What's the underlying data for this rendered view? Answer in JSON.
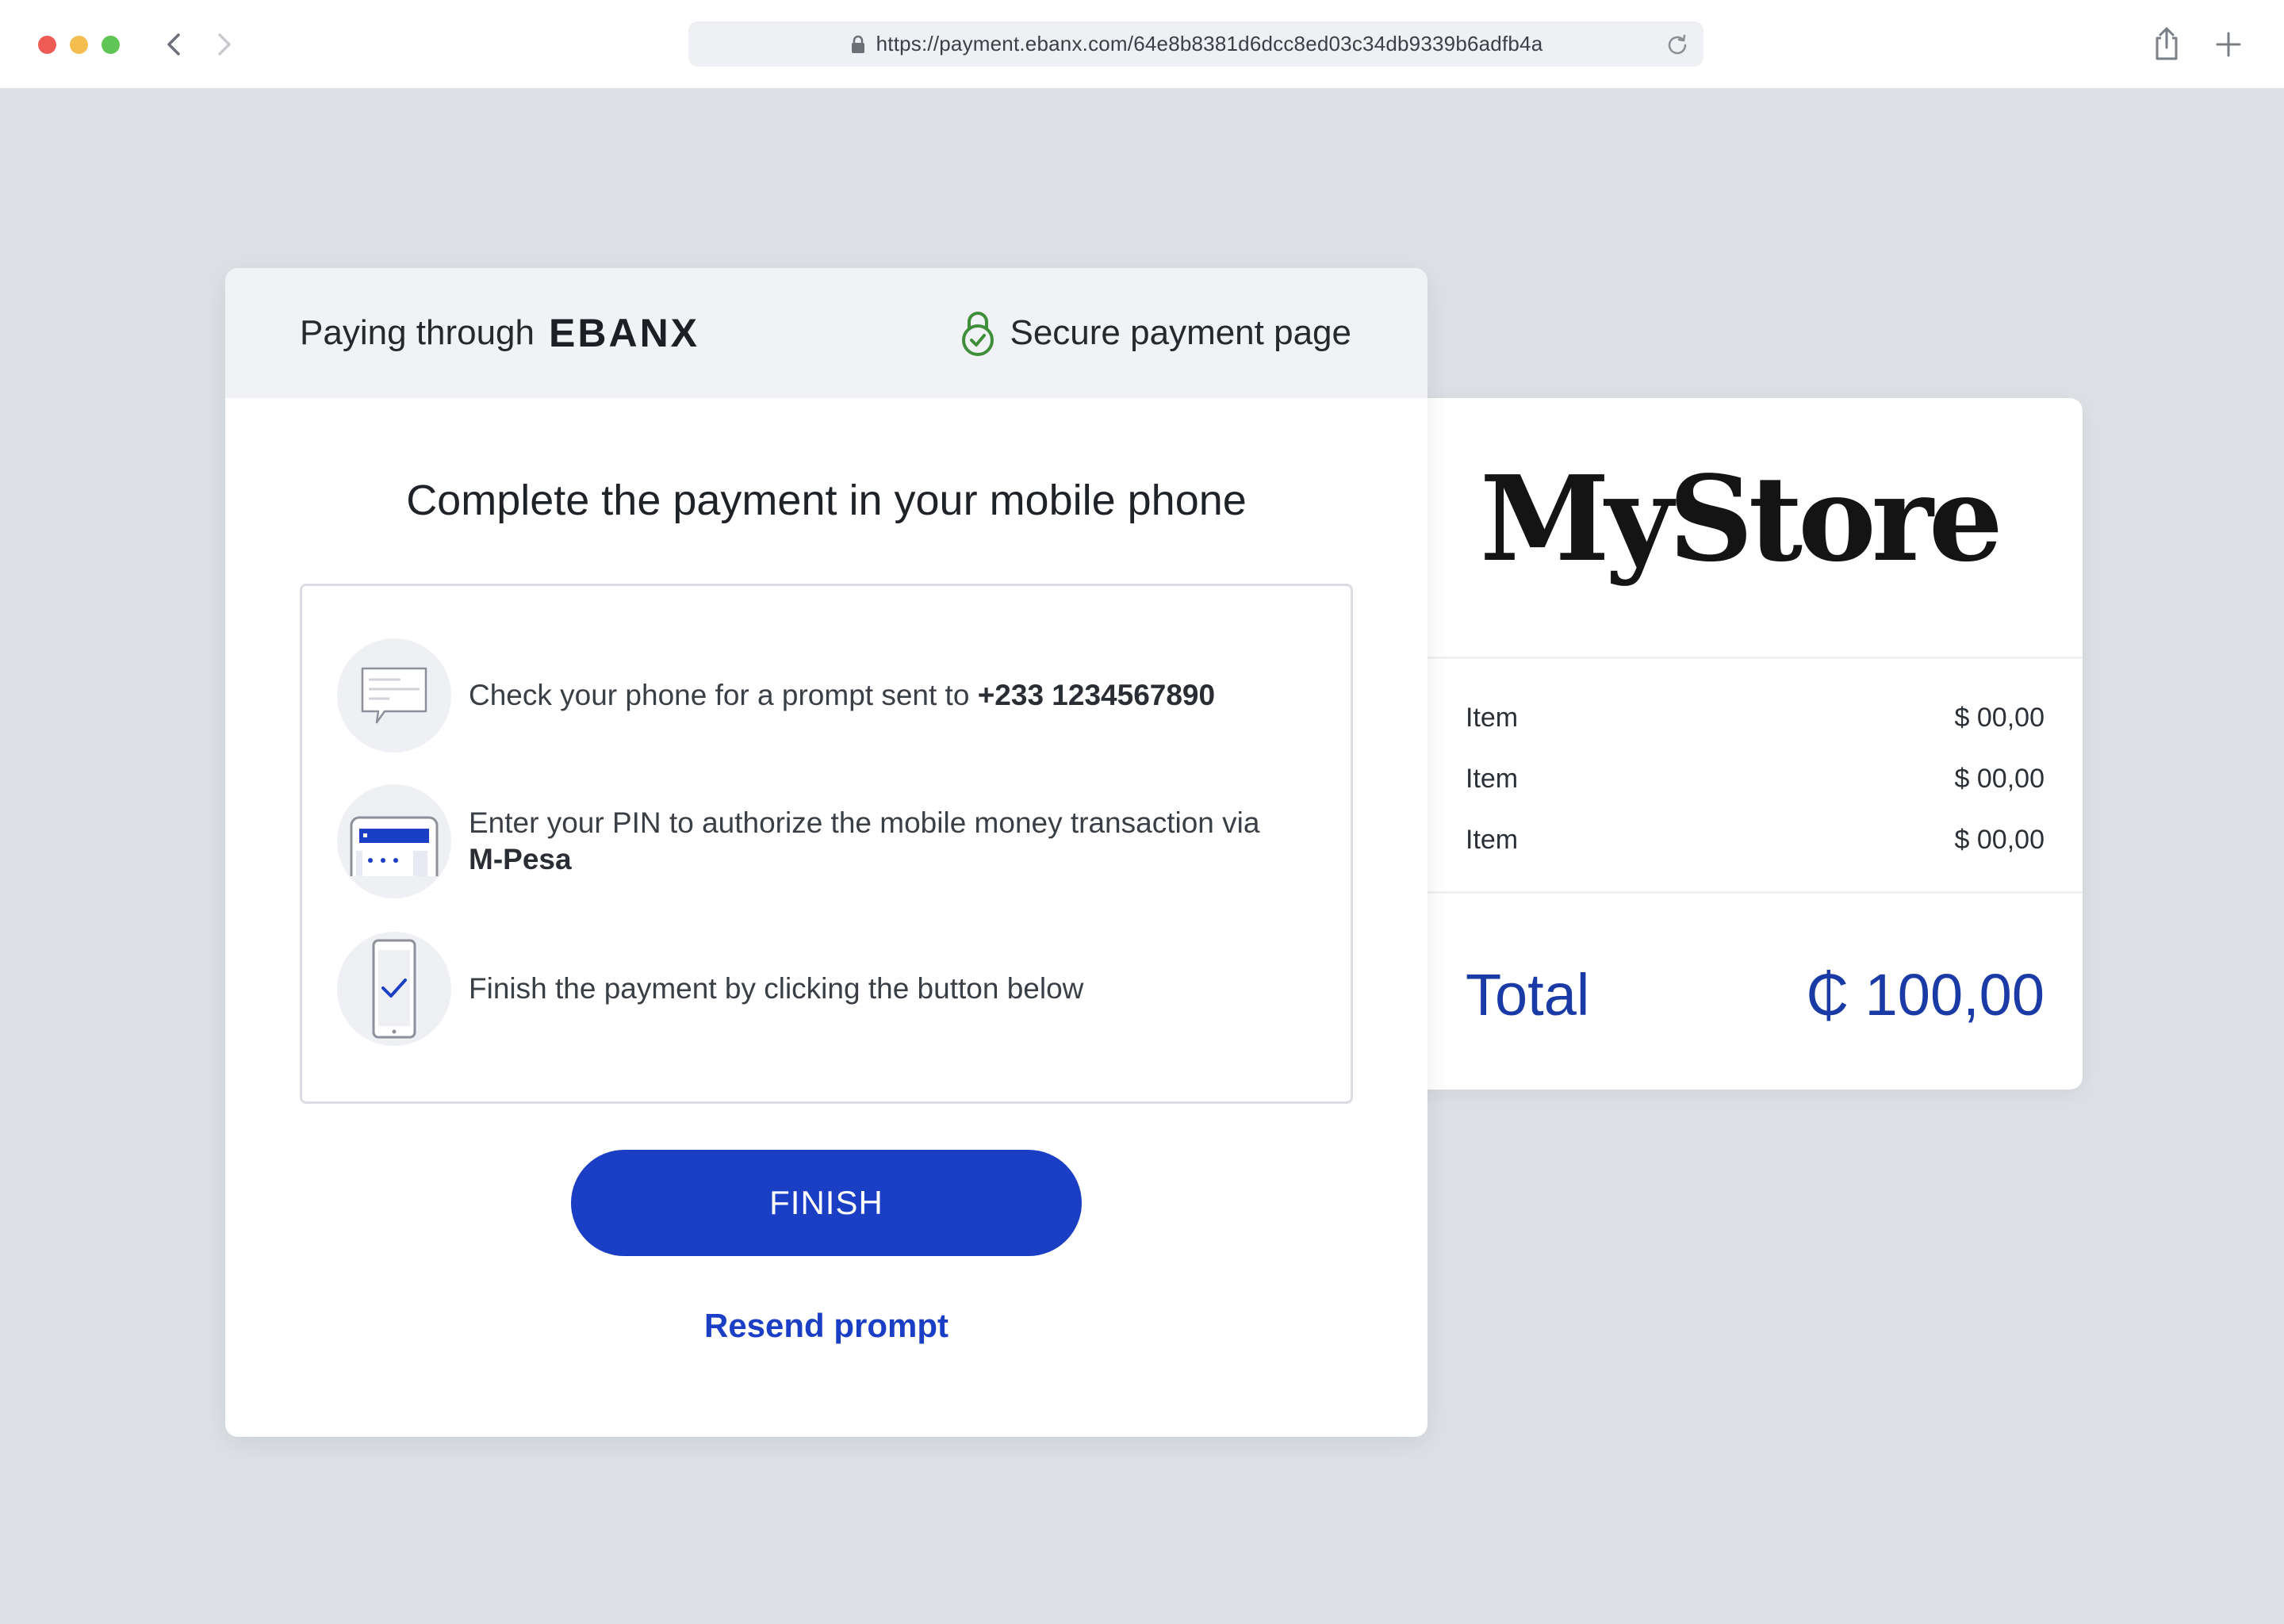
{
  "browser": {
    "url": "https://payment.ebanx.com/64e8b8381d6dcc8ed03c34db9339b6adfb4a",
    "icons": [
      "back-arrow-icon",
      "forward-arrow-icon",
      "lock-icon",
      "reload-icon",
      "share-icon",
      "plus-icon"
    ]
  },
  "header": {
    "paying_label": "Paying through",
    "brand": "EBANX",
    "secure_label": "Secure payment page",
    "secure_color": "#3f8f3a"
  },
  "main": {
    "title": "Complete the payment in your mobile phone",
    "steps": [
      {
        "text": "Check your phone for a prompt sent to ",
        "bold": "+233 1234567890",
        "icon": "message-icon"
      },
      {
        "text": "Enter your PIN to authorize the mobile money transaction via ",
        "bold": "M-Pesa",
        "icon": "pin-keypad-icon"
      },
      {
        "text": "Finish the payment by clicking the button below",
        "bold": "",
        "icon": "phone-check-icon"
      }
    ],
    "finish_label": "FINISH",
    "resend_label": "Resend prompt",
    "accent_color": "#1a3ec4"
  },
  "summary": {
    "store_name": "MyStore",
    "items": [
      {
        "label": "Item",
        "price": "$ 00,00"
      },
      {
        "label": "Item",
        "price": "$ 00,00"
      },
      {
        "label": "Item",
        "price": "$ 00,00"
      }
    ],
    "total_label": "Total",
    "total_value": "₵ 100,00"
  }
}
